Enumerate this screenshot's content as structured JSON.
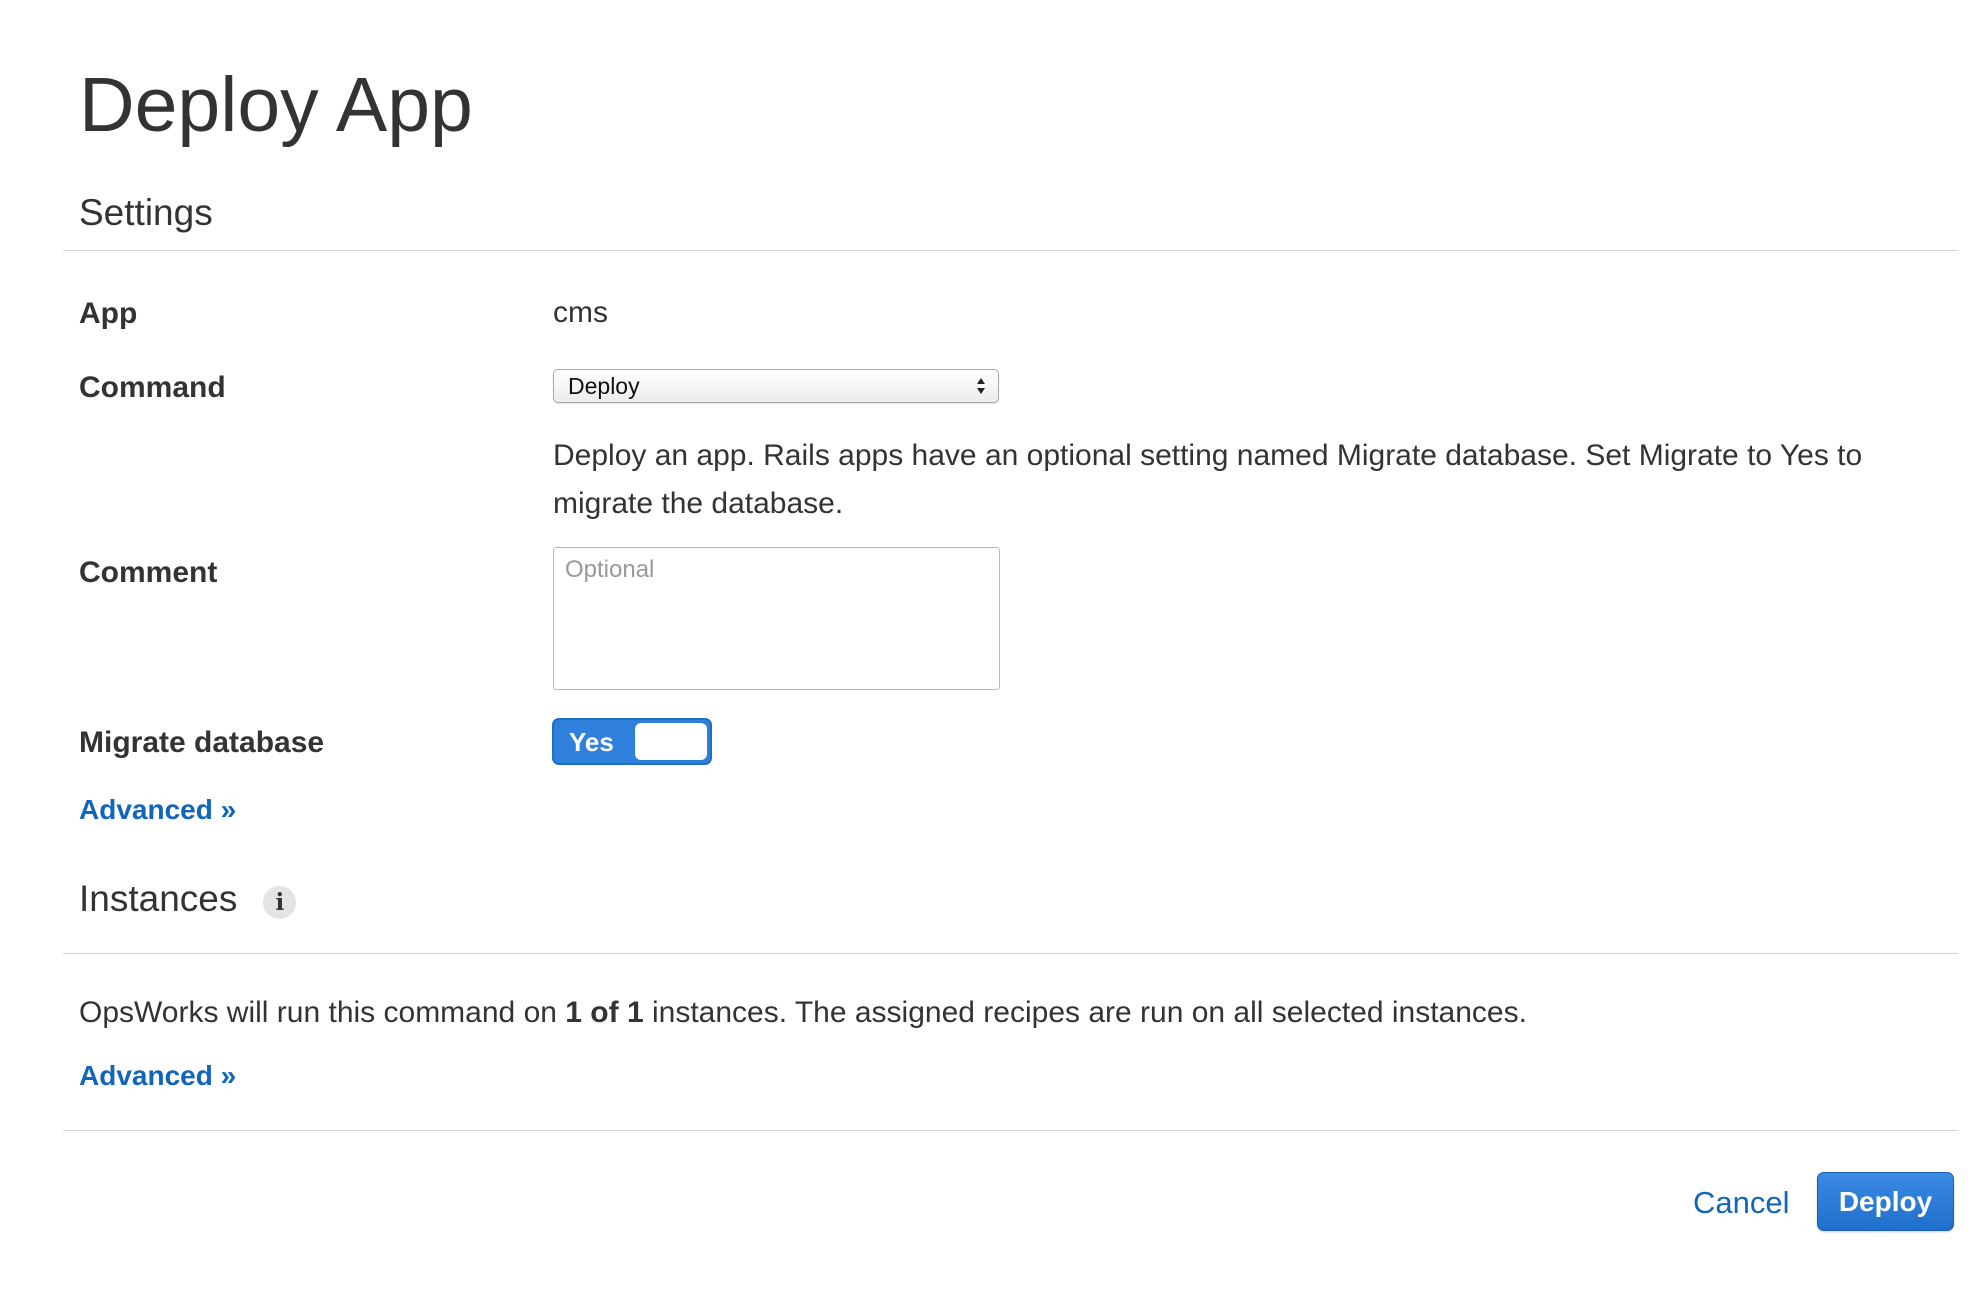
{
  "page": {
    "title": "Deploy App"
  },
  "settings": {
    "section_title": "Settings",
    "app": {
      "label": "App",
      "value": "cms"
    },
    "command": {
      "label": "Command",
      "selected": "Deploy",
      "help_text": "Deploy an app. Rails apps have an optional setting named Migrate database. Set Migrate to Yes to migrate the database."
    },
    "comment": {
      "label": "Comment",
      "value": "",
      "placeholder": "Optional"
    },
    "migrate": {
      "label": "Migrate database",
      "toggle_label": "Yes",
      "state": "on"
    },
    "advanced_link": "Advanced »"
  },
  "instances": {
    "section_title": "Instances",
    "info_icon": "info-icon",
    "text_before": "OpsWorks will run this command on ",
    "count_bold": "1 of 1",
    "text_after": " instances. The assigned recipes are run on all selected instances.",
    "advanced_link": "Advanced »"
  },
  "footer": {
    "cancel_label": "Cancel",
    "deploy_label": "Deploy"
  },
  "colors": {
    "link": "#1166bb",
    "primary": "#2f80dd",
    "text": "#333333",
    "divider": "#d5d5d5"
  }
}
